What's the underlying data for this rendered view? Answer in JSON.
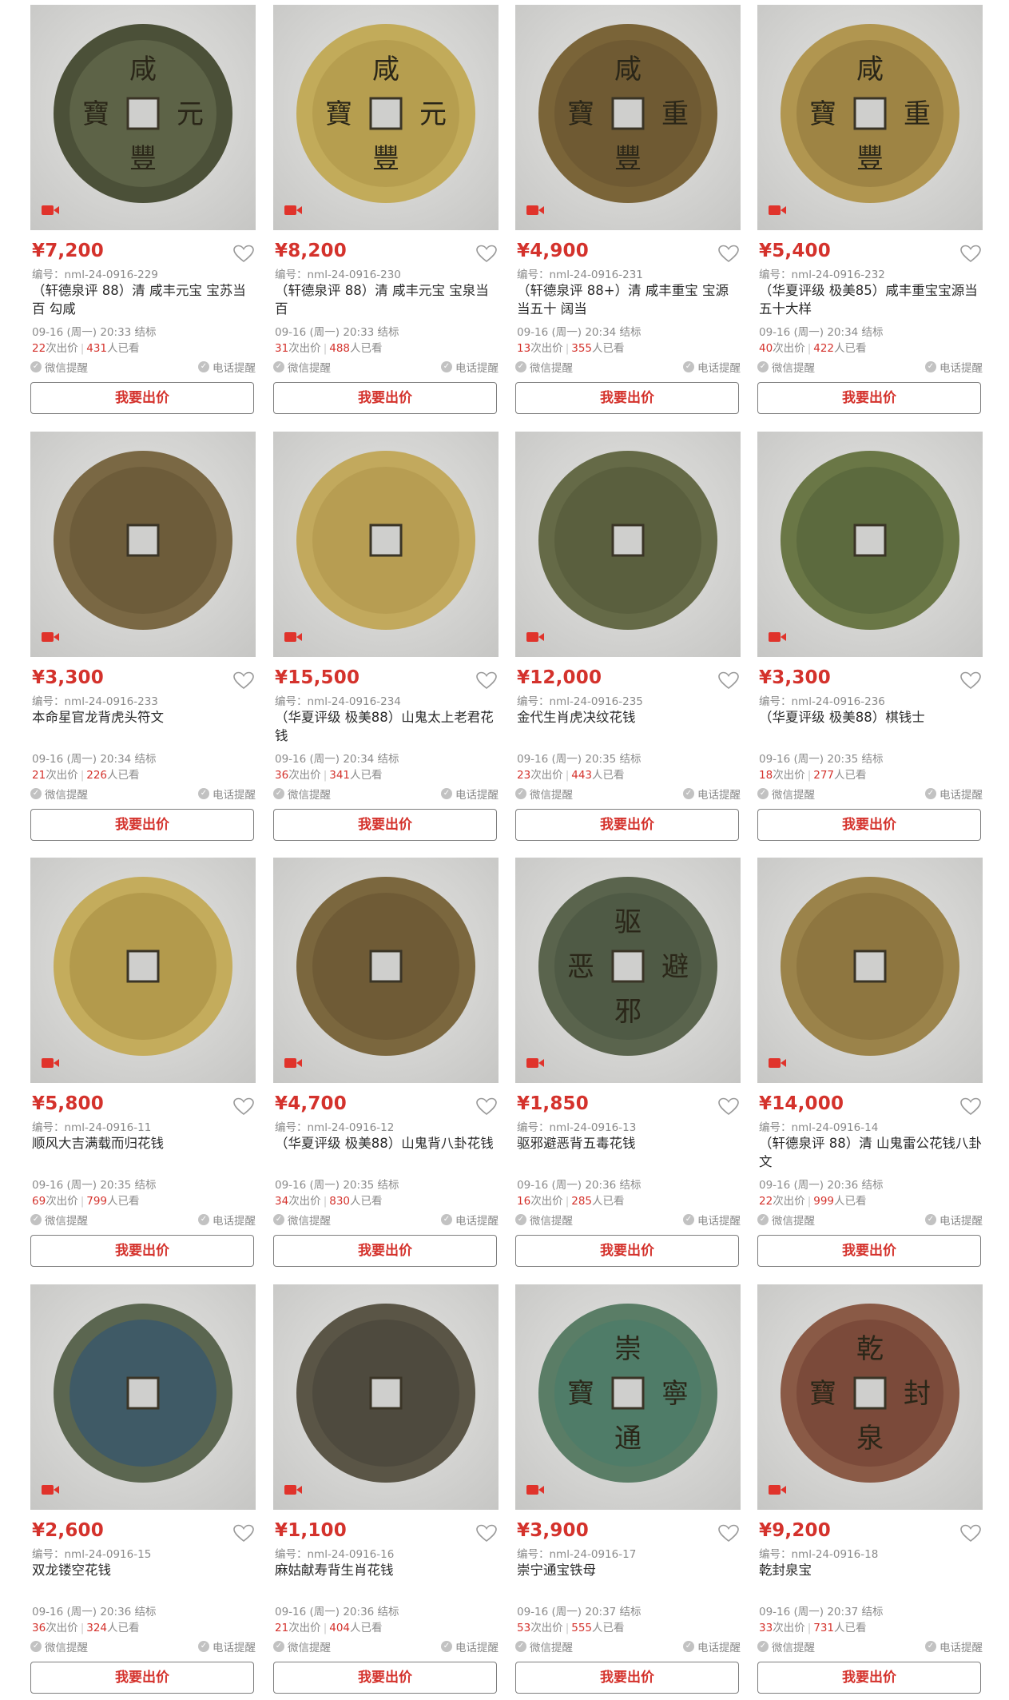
{
  "labels": {
    "code_prefix": "编号：",
    "bids_suffix": "次出价",
    "views_suffix": "人已看",
    "wechat_remind": "微信提醒",
    "phone_remind": "电话提醒",
    "bid_button": "我要出价"
  },
  "colors": {
    "accent": "#d4322c",
    "muted": "#8a8a8a",
    "title": "#2a2a2a"
  },
  "items": [
    {
      "price": "¥7,200",
      "code": "nml-24-0916-229",
      "title": "（轩德泉评 88）清 咸丰元宝 宝苏当百 勾咸",
      "end": "09-16 (周一) 20:33 结标",
      "bids": "22",
      "views": "431",
      "coin": {
        "face": "#5d6347",
        "rim": "#4b5038",
        "chars": [
          "咸",
          "元",
          "豐",
          "寶"
        ]
      }
    },
    {
      "price": "¥8,200",
      "code": "nml-24-0916-230",
      "title": "（轩德泉评 88）清 咸丰元宝 宝泉当百",
      "end": "09-16 (周一) 20:33 结标",
      "bids": "31",
      "views": "488",
      "coin": {
        "face": "#b69e4f",
        "rim": "#c2ab5a",
        "chars": [
          "咸",
          "元",
          "豐",
          "寶"
        ]
      }
    },
    {
      "price": "¥4,900",
      "code": "nml-24-0916-231",
      "title": "（轩德泉评 88+）清 咸丰重宝 宝源当五十 阔当",
      "end": "09-16 (周一) 20:34 结标",
      "bids": "13",
      "views": "355",
      "coin": {
        "face": "#6f5a33",
        "rim": "#7a6438",
        "chars": [
          "咸",
          "重",
          "豐",
          "寶"
        ]
      }
    },
    {
      "price": "¥5,400",
      "code": "nml-24-0916-232",
      "title": "（华夏评级 极美85）咸丰重宝宝源当五十大样",
      "end": "09-16 (周一) 20:34 结标",
      "bids": "40",
      "views": "422",
      "coin": {
        "face": "#9e8444",
        "rim": "#b19650",
        "chars": [
          "咸",
          "重",
          "豐",
          "寶"
        ]
      }
    },
    {
      "price": "¥3,300",
      "code": "nml-24-0916-233",
      "title": "本命星官龙背虎头符文",
      "end": "09-16 (周一) 20:34 结标",
      "bids": "21",
      "views": "226",
      "coin": {
        "face": "#6d5c3a",
        "rim": "#7a6844",
        "chars": []
      }
    },
    {
      "price": "¥15,500",
      "code": "nml-24-0916-234",
      "title": "（华夏评级 极美88）山鬼太上老君花钱",
      "end": "09-16 (周一) 20:34 结标",
      "bids": "36",
      "views": "341",
      "coin": {
        "face": "#b79d52",
        "rim": "#c2a95d",
        "chars": []
      }
    },
    {
      "price": "¥12,000",
      "code": "nml-24-0916-235",
      "title": "金代生肖虎决纹花钱",
      "end": "09-16 (周一) 20:35 结标",
      "bids": "23",
      "views": "443",
      "coin": {
        "face": "#5a5f3e",
        "rim": "#656a47",
        "chars": []
      }
    },
    {
      "price": "¥3,300",
      "code": "nml-24-0916-236",
      "title": "（华夏评级 极美88）棋钱士",
      "end": "09-16 (周一) 20:35 结标",
      "bids": "18",
      "views": "277",
      "coin": {
        "face": "#5c6a3e",
        "rim": "#6a7746",
        "chars": []
      }
    },
    {
      "price": "¥5,800",
      "code": "nml-24-0916-11",
      "title": "顺风大吉满载而归花钱",
      "end": "09-16 (周一) 20:35 结标",
      "bids": "69",
      "views": "799",
      "coin": {
        "face": "#b39a4c",
        "rim": "#c4ac5c",
        "chars": []
      }
    },
    {
      "price": "¥4,700",
      "code": "nml-24-0916-12",
      "title": "（华夏评级 极美88）山鬼背八卦花钱",
      "end": "09-16 (周一) 20:35 结标",
      "bids": "34",
      "views": "830",
      "coin": {
        "face": "#6f5b36",
        "rim": "#7b673e",
        "chars": []
      }
    },
    {
      "price": "¥1,850",
      "code": "nml-24-0916-13",
      "title": "驱邪避恶背五毒花钱",
      "end": "09-16 (周一) 20:36 结标",
      "bids": "16",
      "views": "285",
      "coin": {
        "face": "#4f5a45",
        "rim": "#5a644d",
        "chars": [
          "驱",
          "避",
          "邪",
          "恶"
        ]
      }
    },
    {
      "price": "¥14,000",
      "code": "nml-24-0916-14",
      "title": "（轩德泉评 88）清 山鬼雷公花钱八卦文",
      "end": "09-16 (周一) 20:36 结标",
      "bids": "22",
      "views": "999",
      "coin": {
        "face": "#8e7640",
        "rim": "#9b834a",
        "chars": []
      }
    },
    {
      "price": "¥2,600",
      "code": "nml-24-0916-15",
      "title": "双龙镂空花钱",
      "end": "09-16 (周一) 20:36 结标",
      "bids": "36",
      "views": "324",
      "coin": {
        "face": "#3f5a66",
        "rim": "#5b6650",
        "chars": []
      }
    },
    {
      "price": "¥1,100",
      "code": "nml-24-0916-16",
      "title": "麻姑献寿背生肖花钱",
      "end": "09-16 (周一) 20:36 结标",
      "bids": "21",
      "views": "404",
      "coin": {
        "face": "#4e4a3e",
        "rim": "#5a5546",
        "chars": []
      }
    },
    {
      "price": "¥3,900",
      "code": "nml-24-0916-17",
      "title": "崇宁通宝铁母",
      "end": "09-16 (周一) 20:37 结标",
      "bids": "53",
      "views": "555",
      "coin": {
        "face": "#4f7c68",
        "rim": "#5a7d66",
        "chars": [
          "崇",
          "寧",
          "通",
          "寶"
        ]
      }
    },
    {
      "price": "¥9,200",
      "code": "nml-24-0916-18",
      "title": "乾封泉宝",
      "end": "09-16 (周一) 20:37 结标",
      "bids": "33",
      "views": "731",
      "coin": {
        "face": "#7b4a3a",
        "rim": "#8a5a46",
        "chars": [
          "乾",
          "封",
          "泉",
          "寶"
        ]
      }
    }
  ]
}
